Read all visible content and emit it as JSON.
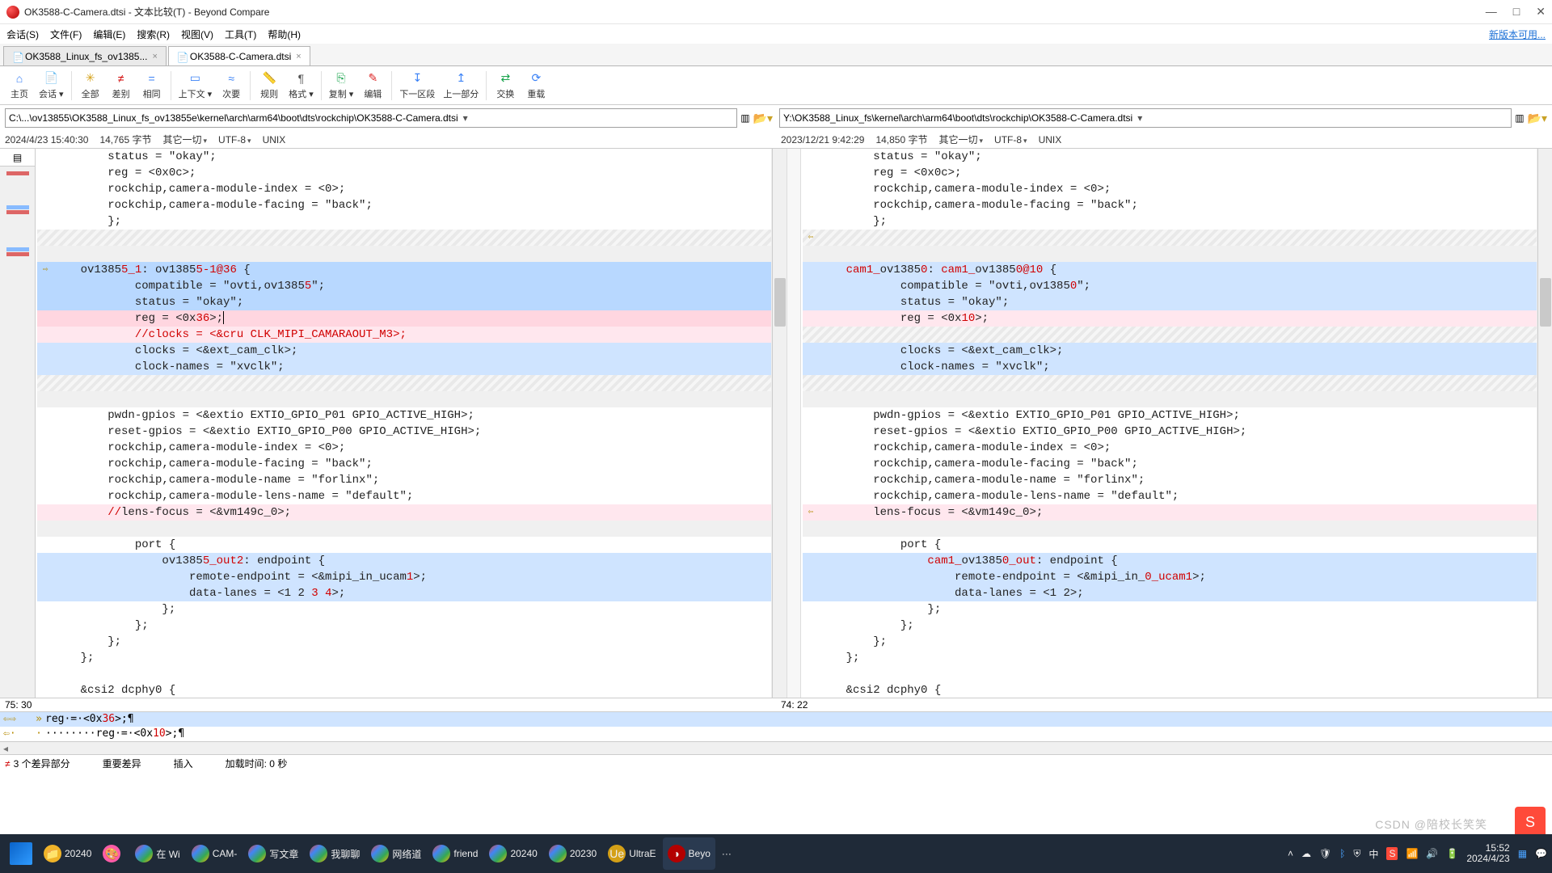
{
  "title": "OK3588-C-Camera.dtsi - 文本比较(T) - Beyond Compare",
  "newver": "新版本可用...",
  "menu": [
    "会话(S)",
    "文件(F)",
    "编辑(E)",
    "搜索(R)",
    "视图(V)",
    "工具(T)",
    "帮助(H)"
  ],
  "tabs": [
    {
      "label": "OK3588_Linux_fs_ov1385...",
      "close": "×",
      "active": false
    },
    {
      "label": "OK3588-C-Camera.dtsi",
      "close": "×",
      "active": true
    }
  ],
  "toolbar": [
    {
      "label": "主页",
      "icon": "⌂",
      "c": "#3b82f6"
    },
    {
      "label": "会话",
      "icon": "📄",
      "c": "#3b82f6",
      "dd": true
    },
    {
      "sep": true
    },
    {
      "label": "全部",
      "icon": "✳",
      "c": "#d4a017"
    },
    {
      "label": "差别",
      "icon": "≠",
      "c": "#d00000"
    },
    {
      "label": "相同",
      "icon": "=",
      "c": "#3b82f6"
    },
    {
      "sep": true
    },
    {
      "label": "上下文",
      "icon": "▭",
      "c": "#3b82f6",
      "dd": true
    },
    {
      "label": "次要",
      "icon": "≈",
      "c": "#3b82f6"
    },
    {
      "sep": true
    },
    {
      "label": "规则",
      "icon": "📏",
      "c": "#d4a017"
    },
    {
      "label": "格式",
      "icon": "¶",
      "c": "#555",
      "dd": true
    },
    {
      "sep": true
    },
    {
      "label": "复制",
      "icon": "⎘",
      "c": "#16a34a",
      "dd": true
    },
    {
      "label": "编辑",
      "icon": "✎",
      "c": "#dc2626"
    },
    {
      "sep": true
    },
    {
      "label": "下一区段",
      "icon": "↧",
      "c": "#3b82f6"
    },
    {
      "label": "上一部分",
      "icon": "↥",
      "c": "#3b82f6"
    },
    {
      "sep": true
    },
    {
      "label": "交换",
      "icon": "⇄",
      "c": "#16a34a"
    },
    {
      "label": "重载",
      "icon": "⟳",
      "c": "#3b82f6"
    }
  ],
  "left": {
    "path": "C:\\...\\ov13855\\OK3588_Linux_fs_ov13855e\\kernel\\arch\\arm64\\boot\\dts\\rockchip\\OK3588-C-Camera.dtsi",
    "meta": {
      "date": "2024/4/23 15:40:30",
      "size": "14,765 字节",
      "other": "其它一切",
      "enc": "UTF-8",
      "eol": "UNIX"
    },
    "pos": "75: 30",
    "lines": [
      {
        "bg": "",
        "g": "",
        "t": "        status = \"okay\";"
      },
      {
        "bg": "",
        "g": "",
        "t": "        reg = <0x0c>;"
      },
      {
        "bg": "",
        "g": "",
        "t": "        rockchip,camera-module-index = <0>;"
      },
      {
        "bg": "",
        "g": "",
        "t": "        rockchip,camera-module-facing = \"back\";"
      },
      {
        "bg": "",
        "g": "",
        "t": "        };"
      },
      {
        "bg": "hatch",
        "g": "",
        "t": ""
      },
      {
        "bg": "gray",
        "g": "",
        "t": ""
      },
      {
        "bg": "selblue",
        "g": "⇨",
        "seg": [
          {
            "t": "    ov1385",
            "r": false
          },
          {
            "t": "5_1",
            "r": true
          },
          {
            "t": ": ov1385",
            "r": false
          },
          {
            "t": "5-1@36",
            "r": true
          },
          {
            "t": " {",
            "r": false
          }
        ]
      },
      {
        "bg": "selblue",
        "g": "",
        "seg": [
          {
            "t": "            compatible = \"ovti,ov1385",
            "r": false
          },
          {
            "t": "5",
            "r": true
          },
          {
            "t": "\";",
            "r": false
          }
        ]
      },
      {
        "bg": "selblue",
        "g": "",
        "t": "            status = \"okay\";"
      },
      {
        "bg": "pink",
        "g": "",
        "seg": [
          {
            "t": "            reg = <0x",
            "r": false
          },
          {
            "t": "36",
            "r": true
          },
          {
            "t": ">;",
            "r": false
          }
        ],
        "caret": true
      },
      {
        "bg": "lightpink",
        "g": "",
        "seg": [
          {
            "t": "            //clocks = <&cru CLK_MIPI_CAMARAOUT_M3>;",
            "r": true
          }
        ]
      },
      {
        "bg": "blue",
        "g": "",
        "t": "            clocks = <&ext_cam_clk>;"
      },
      {
        "bg": "blue",
        "g": "",
        "t": "            clock-names = \"xvclk\";"
      },
      {
        "bg": "hatch",
        "g": "",
        "t": ""
      },
      {
        "bg": "gray",
        "g": "",
        "t": ""
      },
      {
        "bg": "",
        "g": "",
        "t": "        pwdn-gpios = <&extio EXTIO_GPIO_P01 GPIO_ACTIVE_HIGH>;"
      },
      {
        "bg": "",
        "g": "",
        "t": "        reset-gpios = <&extio EXTIO_GPIO_P00 GPIO_ACTIVE_HIGH>;"
      },
      {
        "bg": "",
        "g": "",
        "t": "        rockchip,camera-module-index = <0>;"
      },
      {
        "bg": "",
        "g": "",
        "t": "        rockchip,camera-module-facing = \"back\";"
      },
      {
        "bg": "",
        "g": "",
        "t": "        rockchip,camera-module-name = \"forlinx\";"
      },
      {
        "bg": "",
        "g": "",
        "t": "        rockchip,camera-module-lens-name = \"default\";"
      },
      {
        "bg": "lightpink",
        "g": "",
        "seg": [
          {
            "t": "        //",
            "r": true
          },
          {
            "t": "lens-focus = <&vm149c_0>;",
            "r": false
          }
        ]
      },
      {
        "bg": "gray",
        "g": "",
        "t": ""
      },
      {
        "bg": "",
        "g": "",
        "t": "            port {"
      },
      {
        "bg": "blue",
        "g": "",
        "seg": [
          {
            "t": "                ov1385",
            "r": false
          },
          {
            "t": "5_out2",
            "r": true
          },
          {
            "t": ": endpoint {",
            "r": false
          }
        ]
      },
      {
        "bg": "blue",
        "g": "",
        "seg": [
          {
            "t": "                    remote-endpoint = <&mipi_in_ucam",
            "r": false
          },
          {
            "t": "1",
            "r": true
          },
          {
            "t": ">;",
            "r": false
          }
        ]
      },
      {
        "bg": "blue",
        "g": "",
        "seg": [
          {
            "t": "                    data-lanes = <1 2",
            "r": false
          },
          {
            "t": " 3 4",
            "r": true
          },
          {
            "t": ">;",
            "r": false
          }
        ]
      },
      {
        "bg": "",
        "g": "",
        "t": "                };"
      },
      {
        "bg": "",
        "g": "",
        "t": "            };"
      },
      {
        "bg": "",
        "g": "",
        "t": "        };"
      },
      {
        "bg": "",
        "g": "",
        "t": "    };"
      },
      {
        "bg": "",
        "g": "",
        "t": ""
      },
      {
        "bg": "",
        "g": "",
        "t": "    &csi2 dcphy0 {"
      }
    ]
  },
  "right": {
    "path": "Y:\\OK3588_Linux_fs\\kernel\\arch\\arm64\\boot\\dts\\rockchip\\OK3588-C-Camera.dtsi",
    "meta": {
      "date": "2023/12/21 9:42:29",
      "size": "14,850 字节",
      "other": "其它一切",
      "enc": "UTF-8",
      "eol": "UNIX"
    },
    "pos": "74: 22",
    "lines": [
      {
        "bg": "",
        "g": "",
        "t": "        status = \"okay\";"
      },
      {
        "bg": "",
        "g": "",
        "t": "        reg = <0x0c>;"
      },
      {
        "bg": "",
        "g": "",
        "t": "        rockchip,camera-module-index = <0>;"
      },
      {
        "bg": "",
        "g": "",
        "t": "        rockchip,camera-module-facing = \"back\";"
      },
      {
        "bg": "",
        "g": "",
        "t": "        };"
      },
      {
        "bg": "hatch",
        "g": "⇦",
        "t": ""
      },
      {
        "bg": "gray",
        "g": "",
        "t": ""
      },
      {
        "bg": "blue",
        "g": "",
        "seg": [
          {
            "t": "    ",
            "r": false
          },
          {
            "t": "cam1_",
            "r": true
          },
          {
            "t": "ov1385",
            "r": false
          },
          {
            "t": "0",
            "r": true
          },
          {
            "t": ": ",
            "r": false
          },
          {
            "t": "cam1_",
            "r": true
          },
          {
            "t": "ov1385",
            "r": false
          },
          {
            "t": "0@10",
            "r": true
          },
          {
            "t": " {",
            "r": false
          }
        ]
      },
      {
        "bg": "blue",
        "g": "",
        "seg": [
          {
            "t": "            compatible = \"ovti,ov1385",
            "r": false
          },
          {
            "t": "0",
            "r": true
          },
          {
            "t": "\";",
            "r": false
          }
        ]
      },
      {
        "bg": "blue",
        "g": "",
        "t": "            status = \"okay\";"
      },
      {
        "bg": "lightpink",
        "g": "",
        "seg": [
          {
            "t": "            reg = <0x",
            "r": false
          },
          {
            "t": "10",
            "r": true
          },
          {
            "t": ">;",
            "r": false
          }
        ]
      },
      {
        "bg": "hatch",
        "g": "",
        "t": ""
      },
      {
        "bg": "blue",
        "g": "",
        "t": "            clocks = <&ext_cam_clk>;"
      },
      {
        "bg": "blue",
        "g": "",
        "t": "            clock-names = \"xvclk\";"
      },
      {
        "bg": "hatch",
        "g": "",
        "t": ""
      },
      {
        "bg": "gray",
        "g": "",
        "t": ""
      },
      {
        "bg": "",
        "g": "",
        "t": "        pwdn-gpios = <&extio EXTIO_GPIO_P01 GPIO_ACTIVE_HIGH>;"
      },
      {
        "bg": "",
        "g": "",
        "t": "        reset-gpios = <&extio EXTIO_GPIO_P00 GPIO_ACTIVE_HIGH>;"
      },
      {
        "bg": "",
        "g": "",
        "t": "        rockchip,camera-module-index = <0>;"
      },
      {
        "bg": "",
        "g": "",
        "t": "        rockchip,camera-module-facing = \"back\";"
      },
      {
        "bg": "",
        "g": "",
        "t": "        rockchip,camera-module-name = \"forlinx\";"
      },
      {
        "bg": "",
        "g": "",
        "t": "        rockchip,camera-module-lens-name = \"default\";"
      },
      {
        "bg": "lightpink",
        "g": "⇦",
        "seg": [
          {
            "t": "        lens-focus = <&vm149c_0>;",
            "r": false
          }
        ]
      },
      {
        "bg": "gray",
        "g": "",
        "t": ""
      },
      {
        "bg": "",
        "g": "",
        "t": "            port {"
      },
      {
        "bg": "blue",
        "g": "",
        "seg": [
          {
            "t": "                ",
            "r": false
          },
          {
            "t": "cam1_",
            "r": true
          },
          {
            "t": "ov1385",
            "r": false
          },
          {
            "t": "0_out",
            "r": true
          },
          {
            "t": ": endpoint {",
            "r": false
          }
        ]
      },
      {
        "bg": "blue",
        "g": "",
        "seg": [
          {
            "t": "                    remote-endpoint = <&mipi_in_",
            "r": false
          },
          {
            "t": "0_ucam1",
            "r": true
          },
          {
            "t": ">;",
            "r": false
          }
        ]
      },
      {
        "bg": "blue",
        "g": "",
        "seg": [
          {
            "t": "                    data-lanes = <1 2>;",
            "r": false
          }
        ]
      },
      {
        "bg": "",
        "g": "",
        "t": "                };"
      },
      {
        "bg": "",
        "g": "",
        "t": "            };"
      },
      {
        "bg": "",
        "g": "",
        "t": "        };"
      },
      {
        "bg": "",
        "g": "",
        "t": "    };"
      },
      {
        "bg": "",
        "g": "",
        "t": ""
      },
      {
        "bg": "",
        "g": "",
        "t": "    &csi2 dcphy0 {"
      }
    ]
  },
  "uni": [
    {
      "a": "⇦⇨",
      "b": "»",
      "bg": "blue",
      "seg": [
        {
          "t": "        reg·=·<0x",
          "r": false
        },
        {
          "t": "36",
          "r": true
        },
        {
          "t": ">;¶",
          "r": false
        }
      ]
    },
    {
      "a": "⇦·",
      "b": "·",
      "bg": "",
      "seg": [
        {
          "t": "········reg·=·<0x",
          "r": false
        },
        {
          "t": "10",
          "r": true
        },
        {
          "t": ">;¶",
          "r": false
        }
      ]
    }
  ],
  "status": {
    "diff": "3 个差异部分",
    "major": "重要差异",
    "insert": "插入",
    "load": "加载时间: 0 秒"
  },
  "watermark": "CSDN @陪校长笑笑",
  "taskbar": {
    "items": [
      {
        "label": "20240",
        "icon": "📁",
        "c": "#f0b429"
      },
      {
        "label": "",
        "icon": "🎨",
        "c": "#ff5ca8"
      },
      {
        "label": "在 Wi",
        "icon": "◐",
        "c": "linear-gradient(135deg,#ea4335,#4285f4,#34a853,#fbbc05)"
      },
      {
        "label": "CAM-",
        "icon": "◐",
        "c": "linear-gradient(135deg,#ea4335,#4285f4,#34a853,#fbbc05)"
      },
      {
        "label": "写文章",
        "icon": "◐",
        "c": "linear-gradient(135deg,#ea4335,#4285f4,#34a853,#fbbc05)"
      },
      {
        "label": "我聊聊",
        "icon": "◐",
        "c": "linear-gradient(135deg,#ea4335,#4285f4,#34a853,#fbbc05)"
      },
      {
        "label": "网络道",
        "icon": "◐",
        "c": "linear-gradient(135deg,#ea4335,#4285f4,#34a853,#fbbc05)"
      },
      {
        "label": "friend",
        "icon": "◐",
        "c": "linear-gradient(135deg,#ea4335,#4285f4,#34a853,#fbbc05)"
      },
      {
        "label": "20240",
        "icon": "◐",
        "c": "linear-gradient(135deg,#ea4335,#4285f4,#34a853,#fbbc05)"
      },
      {
        "label": "20230",
        "icon": "◐",
        "c": "linear-gradient(135deg,#ea4335,#4285f4,#34a853,#fbbc05)"
      },
      {
        "label": "UltraE",
        "icon": "Ue",
        "c": "#d4a017"
      },
      {
        "label": "Beyo",
        "icon": "◑",
        "c": "#b30000",
        "active": true
      }
    ],
    "more": "···",
    "tray": {
      "ime": "中",
      "time": "15:52",
      "date": "2024/4/23"
    }
  },
  "winbtns": {
    "min": "—",
    "max": "□",
    "close": "✕"
  }
}
